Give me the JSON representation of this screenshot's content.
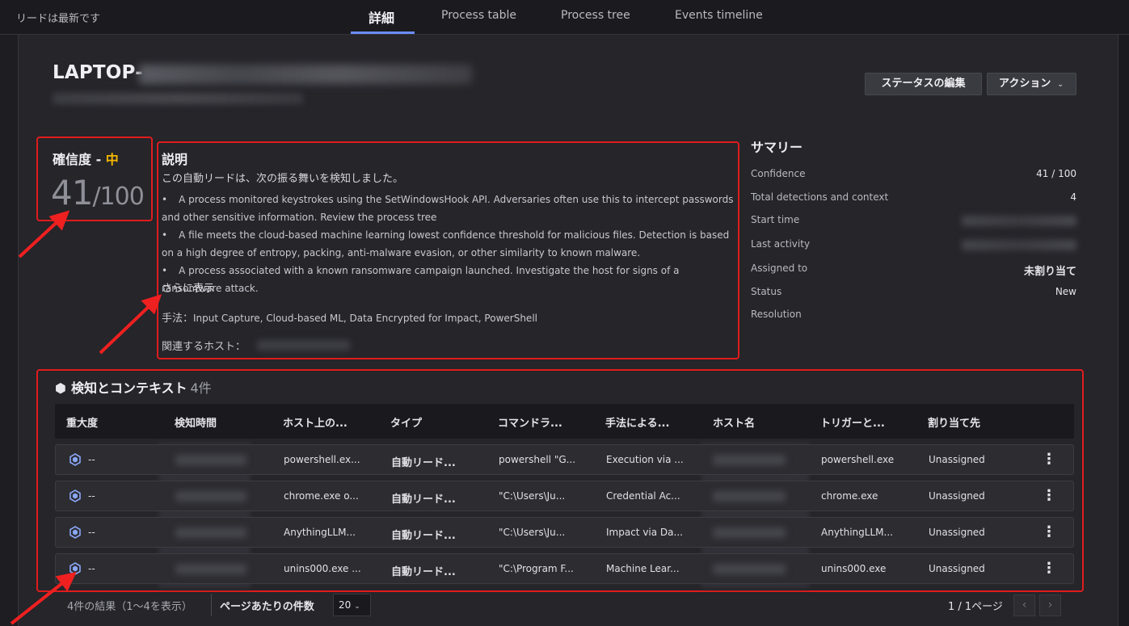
{
  "topbar": {
    "status": "リードは最新です",
    "tabs": [
      {
        "label": "詳細",
        "active": true
      },
      {
        "label": "Process table",
        "active": false
      },
      {
        "label": "Process tree",
        "active": false
      },
      {
        "label": "Events timeline",
        "active": false
      }
    ]
  },
  "header": {
    "host_title": "LAPTOP-",
    "edit_status_button": "ステータスの編集",
    "action_button": "アクション"
  },
  "confidence": {
    "label": "確信度 - ",
    "level": "中",
    "score": "41",
    "denominator": "/100"
  },
  "description": {
    "title": "説明",
    "intro": "この自動リードは、次の振る舞いを検知しました。",
    "items": [
      "A process monitored keystrokes using the SetWindowsHook API. Adversaries often use this to intercept passwords and other sensitive information. Review the process tree",
      "A file meets the cloud-based machine learning lowest confidence threshold for malicious files. Detection is based on a high degree of entropy, packing, anti-malware evasion, or other similarity to known malware.",
      "A process associated with a known ransomware campaign launched. Investigate the host for signs of a ransomware attack."
    ],
    "show_more": "さらに表示",
    "tactics_label": "手法：",
    "tactics_value": "Input Capture, Cloud-based ML, Data Encrypted for Impact, PowerShell",
    "related_hosts_label": "関連するホスト："
  },
  "summary": {
    "title": "サマリー",
    "rows": [
      {
        "key": "Confidence",
        "value": "41 / 100"
      },
      {
        "key": "Total detections and context",
        "value": "4"
      },
      {
        "key": "Start time",
        "value": ""
      },
      {
        "key": "Last activity",
        "value": ""
      },
      {
        "key": "Assigned to",
        "value": "未割り当て"
      },
      {
        "key": "Status",
        "value": "New"
      },
      {
        "key": "Resolution",
        "value": ""
      }
    ]
  },
  "detections": {
    "title": "検知とコンテキスト",
    "count": "4件",
    "columns": [
      "重大度",
      "検知時間",
      "ホスト上の...",
      "タイプ",
      "コマンドラ...",
      "手法による...",
      "ホスト名",
      "トリガーと...",
      "割り当て先"
    ],
    "rows": [
      {
        "severity": "--",
        "process": "powershell.ex...",
        "type": "自動リード...",
        "command": "powershell \"G...",
        "tactic": "Execution via ...",
        "trigger": "powershell.exe",
        "assignee": "Unassigned"
      },
      {
        "severity": "--",
        "process": "chrome.exe o...",
        "type": "自動リード...",
        "command": "\"C:\\Users\\Ju...",
        "tactic": "Credential Ac...",
        "trigger": "chrome.exe",
        "assignee": "Unassigned"
      },
      {
        "severity": "--",
        "process": "AnythingLLM...",
        "type": "自動リード...",
        "command": "\"C:\\Users\\Ju...",
        "tactic": "Impact via Da...",
        "trigger": "AnythingLLM...",
        "assignee": "Unassigned"
      },
      {
        "severity": "--",
        "process": "unins000.exe ...",
        "type": "自動リード...",
        "command": "\"C:\\Program F...",
        "tactic": "Machine Lear...",
        "trigger": "unins000.exe",
        "assignee": "Unassigned"
      }
    ]
  },
  "pagination": {
    "summary": "4件の結果（1〜4を表示）",
    "per_page_label": "ページあたりの件数",
    "per_page_value": "20",
    "page_info": "1 / 1ページ",
    "prev": "‹",
    "next": "›"
  },
  "colors": {
    "accent": "#6c8dfa",
    "highlight_border": "#e01c1c",
    "confidence_medium": "#f5b800",
    "severity_icon": "#8aa6f5"
  }
}
